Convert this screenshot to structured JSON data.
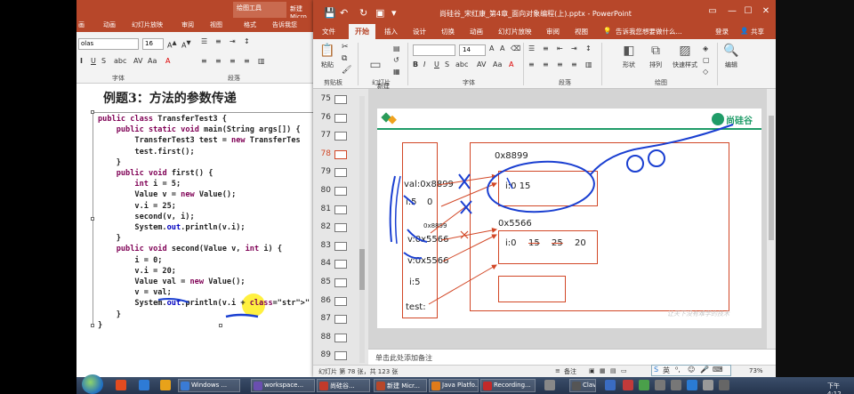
{
  "back_window": {
    "context_tab": "绘图工具",
    "context_sub": "格式",
    "title_partial": "新建 Micro",
    "tabs": [
      "画",
      "动画",
      "幻灯片放映",
      "审阅",
      "视图",
      "格式"
    ],
    "search_hint": "告诉我您",
    "font_name": "olas",
    "font_size": "16",
    "group_labels": [
      "字体",
      "段落"
    ],
    "slide_heading": "例题3：方法的参数传递",
    "code_lines": [
      "public class TransferTest3 {",
      "    public static void main(String args[]) {",
      "        TransferTest3 test = new TransferTes",
      "        test.first();",
      "    }",
      "    public void first() {",
      "        int i = 5;",
      "        Value v = new Value();",
      "        v.i = 25;",
      "        second(v, i);",
      "        System.out.println(v.i);",
      "    }",
      "    public void second(Value v, int i) {",
      "        i = 0;",
      "        v.i = 20;",
      "        Value val = new Value();",
      "        v = val;",
      "        System.out.println(v.i + \" \" + i);",
      "    }",
      "}"
    ]
  },
  "front_window": {
    "title": "尚硅谷_宋红康_第4章_面向对象编程(上).pptx - PowerPoint",
    "tabs": [
      "文件",
      "开始",
      "插入",
      "设计",
      "切换",
      "动画",
      "幻灯片放映",
      "审阅",
      "视图"
    ],
    "active_tab": "开始",
    "search_hint": "告诉我您想要做什么...",
    "login": "登录",
    "share": "共享",
    "ribbon": {
      "paste": "粘贴",
      "new_slide": "新建\n幻灯片",
      "font_size": "14",
      "shape": "形状",
      "arrange": "排列",
      "quick_style": "快速样式",
      "edit": "编辑",
      "groups": [
        "剪贴板",
        "幻灯片",
        "字体",
        "段落",
        "绘图"
      ]
    },
    "thumbnails": [
      {
        "num": "75",
        "selected": false
      },
      {
        "num": "76",
        "selected": false
      },
      {
        "num": "77",
        "selected": false
      },
      {
        "num": "78",
        "selected": true
      },
      {
        "num": "79",
        "selected": false
      },
      {
        "num": "80",
        "selected": false
      },
      {
        "num": "81",
        "selected": false
      },
      {
        "num": "82",
        "selected": false
      },
      {
        "num": "83",
        "selected": false
      },
      {
        "num": "84",
        "selected": false
      },
      {
        "num": "85",
        "selected": false
      },
      {
        "num": "86",
        "selected": false
      },
      {
        "num": "87",
        "selected": false
      },
      {
        "num": "88",
        "selected": false
      },
      {
        "num": "89",
        "selected": false
      }
    ],
    "slide": {
      "logo_text": "尚硅谷",
      "watermark": "让天下没有难学的技术",
      "stack": {
        "val_label": "val:0x8899",
        "i5_label": "i:5",
        "zero": "0",
        "small_addr": "0x8899",
        "v_label_1": "v:0x5566",
        "v_label_2": "v:0x5566",
        "i_label": "i:5",
        "test_label": "test:"
      },
      "heap": {
        "addr_top": "0x8899",
        "obj_top": "i:0  15",
        "addr_mid": "0x5566",
        "obj_mid_i": "i:0",
        "obj_mid_15": "15",
        "obj_mid_25": "25",
        "obj_mid_20": "20"
      }
    },
    "notes_placeholder": "单击此处添加备注",
    "status": {
      "slide_info": "幻灯片 第 78 张，共 123 张",
      "notes_btn": "备注",
      "zoom": "73%"
    },
    "ime": "英"
  },
  "taskbar": {
    "items": [
      "Windows ...",
      "workspace...",
      "尚硅谷...",
      "新建 Micr...",
      "Java Platfo...",
      "Recording...",
      "Clavi"
    ],
    "clock": "下午 4:12"
  },
  "colors": {
    "ppt_red": "#b7472a",
    "diagram_red": "#d24726",
    "ink_blue": "#1a3fd1"
  }
}
